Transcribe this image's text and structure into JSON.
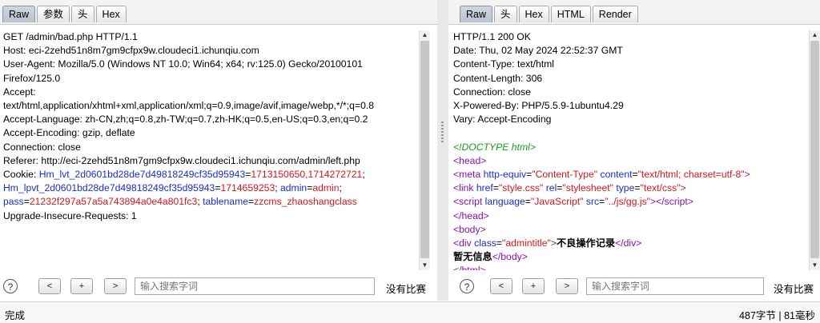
{
  "request": {
    "tabs": [
      "Raw",
      "参数",
      "头",
      "Hex"
    ],
    "active_tab": "Raw",
    "lines": [
      [
        {
          "t": "GET /admin/bad.php HTTP/1.1"
        }
      ],
      [
        {
          "t": "Host: eci-2zehd51n8m7gm9cfpx9w.cloudeci1.ichunqiu.com"
        }
      ],
      [
        {
          "t": "User-Agent: Mozilla/5.0 (Windows NT 10.0; Win64; x64; rv:125.0) Gecko/20100101"
        }
      ],
      [
        {
          "t": "Firefox/125.0"
        }
      ],
      [
        {
          "t": "Accept:"
        }
      ],
      [
        {
          "t": "text/html,application/xhtml+xml,application/xml;q=0.9,image/avif,image/webp,*/*;q=0.8"
        }
      ],
      [
        {
          "t": "Accept-Language: zh-CN,zh;q=0.8,zh-TW;q=0.7,zh-HK;q=0.5,en-US;q=0.3,en;q=0.2"
        }
      ],
      [
        {
          "t": "Accept-Encoding: gzip, deflate"
        }
      ],
      [
        {
          "t": "Connection: close"
        }
      ],
      [
        {
          "t": "Referer: http://eci-2zehd51n8m7gm9cfpx9w.cloudeci1.ichunqiu.com/admin/left.php"
        }
      ],
      [
        {
          "t": "Cookie: "
        },
        {
          "t": "Hm_lvt_2d0601bd28de7d49818249cf35d95943",
          "c": "blue"
        },
        {
          "t": "="
        },
        {
          "t": "1713150650,1714272721",
          "c": "red"
        },
        {
          "t": ";"
        }
      ],
      [
        {
          "t": "Hm_lpvt_2d0601bd28de7d49818249cf35d95943",
          "c": "blue"
        },
        {
          "t": "="
        },
        {
          "t": "1714659253",
          "c": "red"
        },
        {
          "t": "; "
        },
        {
          "t": "admin",
          "c": "blue"
        },
        {
          "t": "="
        },
        {
          "t": "admin",
          "c": "red"
        },
        {
          "t": ";"
        }
      ],
      [
        {
          "t": "pass",
          "c": "blue"
        },
        {
          "t": "="
        },
        {
          "t": "21232f297a57a5a743894a0e4a801fc3",
          "c": "red"
        },
        {
          "t": "; "
        },
        {
          "t": "tablename",
          "c": "blue"
        },
        {
          "t": "="
        },
        {
          "t": "zzcms_zhaoshangclass",
          "c": "red"
        }
      ],
      [
        {
          "t": "Upgrade-Insecure-Requests: 1"
        }
      ]
    ],
    "search_placeholder": "输入搜索字词",
    "no_match": "没有比赛",
    "nav": {
      "help": "?",
      "prev": "<",
      "add": "+",
      "next": ">"
    }
  },
  "response": {
    "tabs": [
      "Raw",
      "头",
      "Hex",
      "HTML",
      "Render"
    ],
    "active_tab": "Raw",
    "lines": [
      [
        {
          "t": "HTTP/1.1 200 OK"
        }
      ],
      [
        {
          "t": "Date: Thu, 02 May 2024 22:52:37 GMT"
        }
      ],
      [
        {
          "t": "Content-Type: text/html"
        }
      ],
      [
        {
          "t": "Content-Length: 306"
        }
      ],
      [
        {
          "t": "Connection: close"
        }
      ],
      [
        {
          "t": "X-Powered-By: PHP/5.5.9-1ubuntu4.29"
        }
      ],
      [
        {
          "t": "Vary: Accept-Encoding"
        }
      ],
      [
        {
          "t": ""
        }
      ],
      [
        {
          "t": "<!DOCTYPE html>",
          "c": "green"
        }
      ],
      [
        {
          "t": "<",
          "c": "purple"
        },
        {
          "t": "head",
          "c": "purple"
        },
        {
          "t": ">",
          "c": "purple"
        }
      ],
      [
        {
          "t": "<",
          "c": "purple"
        },
        {
          "t": "meta",
          "c": "purple"
        },
        {
          "t": " "
        },
        {
          "t": "http-equiv",
          "c": "blue"
        },
        {
          "t": "="
        },
        {
          "t": "\"Content-Type\"",
          "c": "red"
        },
        {
          "t": " "
        },
        {
          "t": "content",
          "c": "blue"
        },
        {
          "t": "="
        },
        {
          "t": "\"text/html; charset=utf-8\"",
          "c": "red"
        },
        {
          "t": ">",
          "c": "purple"
        }
      ],
      [
        {
          "t": "<",
          "c": "purple"
        },
        {
          "t": "link",
          "c": "purple"
        },
        {
          "t": " "
        },
        {
          "t": "href",
          "c": "blue"
        },
        {
          "t": "="
        },
        {
          "t": "\"style.css\"",
          "c": "red"
        },
        {
          "t": " "
        },
        {
          "t": "rel",
          "c": "blue"
        },
        {
          "t": "="
        },
        {
          "t": "\"stylesheet\"",
          "c": "red"
        },
        {
          "t": " "
        },
        {
          "t": "type",
          "c": "blue"
        },
        {
          "t": "="
        },
        {
          "t": "\"text/css\"",
          "c": "red"
        },
        {
          "t": ">",
          "c": "purple"
        }
      ],
      [
        {
          "t": "<",
          "c": "purple"
        },
        {
          "t": "script",
          "c": "purple"
        },
        {
          "t": " "
        },
        {
          "t": "language",
          "c": "blue"
        },
        {
          "t": "="
        },
        {
          "t": "\"JavaScript\"",
          "c": "red"
        },
        {
          "t": " "
        },
        {
          "t": "src",
          "c": "blue"
        },
        {
          "t": "="
        },
        {
          "t": "\"../js/gg.js\"",
          "c": "red"
        },
        {
          "t": ">",
          "c": "purple"
        },
        {
          "t": "</",
          "c": "purple"
        },
        {
          "t": "script",
          "c": "purple"
        },
        {
          "t": ">",
          "c": "purple"
        }
      ],
      [
        {
          "t": "</",
          "c": "purple"
        },
        {
          "t": "head",
          "c": "purple"
        },
        {
          "t": ">",
          "c": "purple"
        }
      ],
      [
        {
          "t": "<",
          "c": "purple"
        },
        {
          "t": "body",
          "c": "purple"
        },
        {
          "t": ">",
          "c": "purple"
        }
      ],
      [
        {
          "t": "<",
          "c": "purple"
        },
        {
          "t": "div",
          "c": "purple"
        },
        {
          "t": " "
        },
        {
          "t": "class",
          "c": "blue"
        },
        {
          "t": "="
        },
        {
          "t": "\"admintitle\"",
          "c": "red"
        },
        {
          "t": ">",
          "c": "purple"
        },
        {
          "t": "不良操作记录",
          "c": "bold"
        },
        {
          "t": "</",
          "c": "purple"
        },
        {
          "t": "div",
          "c": "purple"
        },
        {
          "t": ">",
          "c": "purple"
        }
      ],
      [
        {
          "t": "暂无信息",
          "c": "bold"
        },
        {
          "t": "</",
          "c": "purple"
        },
        {
          "t": "body",
          "c": "purple"
        },
        {
          "t": ">",
          "c": "purple"
        }
      ],
      [
        {
          "t": "</",
          "c": "purple"
        },
        {
          "t": "html",
          "c": "purple"
        },
        {
          "t": ">",
          "c": "purple"
        }
      ]
    ],
    "search_placeholder": "输入搜索字词",
    "no_match": "没有比赛",
    "nav": {
      "help": "?",
      "prev": "<",
      "add": "+",
      "next": ">"
    }
  },
  "status": {
    "left": "完成",
    "right": "487字节 | 81毫秒"
  },
  "colors": {
    "key_blue": "#1a2ec5",
    "value_red": "#d0161e",
    "tag_purple": "#8b10ae",
    "doctype_green": "#189c1a"
  },
  "icons": {
    "scroll_up": "▲",
    "scroll_down": "▼"
  }
}
